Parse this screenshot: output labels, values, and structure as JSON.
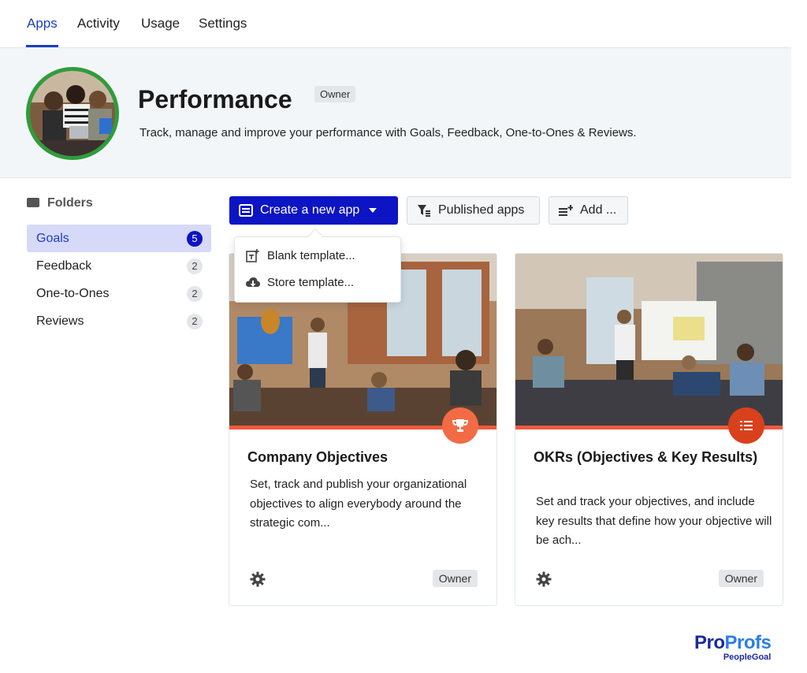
{
  "tabs": [
    {
      "label": "Apps",
      "active": true
    },
    {
      "label": "Activity",
      "active": false
    },
    {
      "label": "Usage",
      "active": false
    },
    {
      "label": "Settings",
      "active": false
    }
  ],
  "hero": {
    "title": "Performance",
    "role_badge": "Owner",
    "description": "Track, manage and improve your performance with Goals, Feedback, One-to-Ones & Reviews."
  },
  "sidebar": {
    "heading": "Folders",
    "items": [
      {
        "label": "Goals",
        "count": "5",
        "active": true
      },
      {
        "label": "Feedback",
        "count": "2",
        "active": false
      },
      {
        "label": "One-to-Ones",
        "count": "2",
        "active": false
      },
      {
        "label": "Reviews",
        "count": "2",
        "active": false
      }
    ]
  },
  "toolbar": {
    "create_label": "Create a new app",
    "published_label": "Published apps",
    "add_label": "Add ..."
  },
  "create_menu": {
    "items": [
      {
        "label": "Blank template...",
        "icon": "blank-template-icon"
      },
      {
        "label": "Store template...",
        "icon": "cloud-download-icon"
      }
    ]
  },
  "cards": [
    {
      "title": "Company Objectives",
      "description": "Set, track and publish your organizational objectives to align everybody around the strategic com...",
      "badge_icon": "trophy-icon",
      "badge_color": "#f26b45",
      "role": "Owner"
    },
    {
      "title": "OKRs (Objectives & Key Results)",
      "description": "Set and track your objectives, and include key results that define how your objective will be ach...",
      "badge_icon": "list-icon",
      "badge_color": "#d9411c",
      "role": "Owner"
    }
  ],
  "colors": {
    "primary": "#0d14c4",
    "accent_bar": "#f05a3c",
    "avatar_ring": "#2e9d3a"
  },
  "logo": {
    "part1": "Pro",
    "part2": "Profs",
    "sub": "PeopleGoal"
  }
}
